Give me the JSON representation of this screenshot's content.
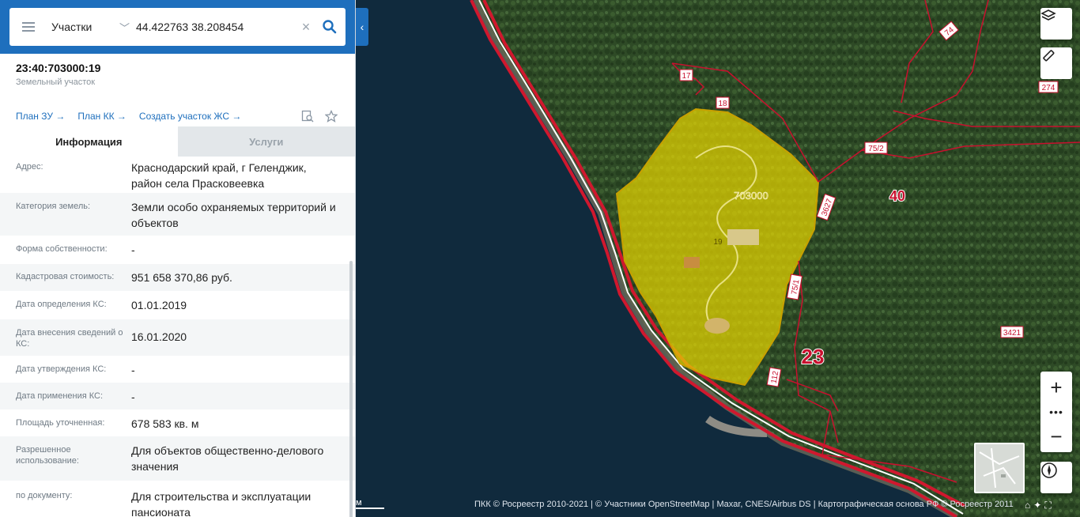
{
  "search": {
    "type_label": "Участки",
    "query": "44.422763 38.208454"
  },
  "parcel": {
    "cadastral_number": "23:40:703000:19",
    "type": "Земельный участок"
  },
  "links": [
    "План ЗУ →",
    "План КК →",
    "Создать участок ЖС →"
  ],
  "tabs": [
    "Информация",
    "Услуги"
  ],
  "info_rows": [
    {
      "label": "Адрес:",
      "value": "Краснодарский край, г Геленджик, район села Прасковеевка"
    },
    {
      "label": "Категория земель:",
      "value": "Земли особо охраняемых территорий и объектов"
    },
    {
      "label": "Форма собственности:",
      "value": "-"
    },
    {
      "label": "Кадастровая стоимость:",
      "value": "951 658 370,86 руб."
    },
    {
      "label": "Дата определения КС:",
      "value": "01.01.2019"
    },
    {
      "label": "Дата внесения сведений о КС:",
      "value": "16.01.2020"
    },
    {
      "label": "Дата утверждения КС:",
      "value": "-"
    },
    {
      "label": "Дата применения КС:",
      "value": "-"
    },
    {
      "label": "Площадь уточненная:",
      "value": "678 583 кв. м"
    },
    {
      "label": "Разрешенное использование:",
      "value": "Для объектов общественно-делового значения"
    },
    {
      "label": "по документу:",
      "value": "Для строительства и эксплуатации пансионата"
    }
  ],
  "map": {
    "labels": {
      "big_40": "40",
      "big_23": "23",
      "parcel_703000": "703000",
      "parcel_19": "19",
      "l17": "17",
      "l18": "18",
      "l74": "74",
      "l274": "274",
      "l75_2": "75/2",
      "l3627": "3627",
      "l75_1": "75/1",
      "l3421": "3421",
      "l112": "112"
    },
    "attribution": "ПКК © Росреестр 2010-2021 | © Участники OpenStreetMap | Maxar, CNES/Airbus DS | Картографическая основа РФ © Росреестр 2011",
    "scale_label": "м",
    "colors": {
      "accent": "#1e6fbd",
      "parcel_fill": "#e5d400",
      "boundary": "#c8102e",
      "sea": "#102a3d"
    }
  }
}
